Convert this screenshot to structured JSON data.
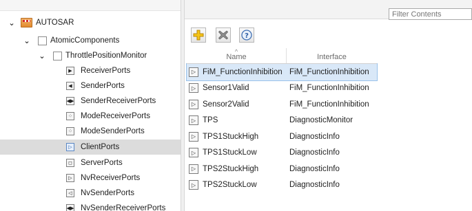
{
  "tree": {
    "root": {
      "label": "AUTOSAR",
      "expanded": true,
      "icon": "autosar-package-icon"
    },
    "package": {
      "label": "AtomicComponents",
      "expanded": true,
      "icon": "folder-icon"
    },
    "component": {
      "label": "ThrottlePositionMonitor",
      "expanded": true,
      "icon": "folder-icon"
    },
    "children": [
      {
        "label": "ReceiverPorts",
        "icon": "receiver-port-icon",
        "glyph": "▶",
        "selected": false
      },
      {
        "label": "SenderPorts",
        "icon": "sender-port-icon",
        "glyph": "◀",
        "selected": false
      },
      {
        "label": "SenderReceiverPorts",
        "icon": "sender-receiver-port-icon",
        "glyph": "◀▶",
        "selected": false
      },
      {
        "label": "ModeReceiverPorts",
        "icon": "mode-receiver-port-icon",
        "glyph": "⁘",
        "selected": false
      },
      {
        "label": "ModeSenderPorts",
        "icon": "mode-sender-port-icon",
        "glyph": "⁘",
        "selected": false
      },
      {
        "label": "ClientPorts",
        "icon": "client-port-icon",
        "glyph": "▷",
        "selected": true
      },
      {
        "label": "ServerPorts",
        "icon": "server-port-icon",
        "glyph": "◻",
        "selected": false
      },
      {
        "label": "NvReceiverPorts",
        "icon": "nv-receiver-port-icon",
        "glyph": "▷",
        "selected": false
      },
      {
        "label": "NvSenderPorts",
        "icon": "nv-sender-port-icon",
        "glyph": "◁",
        "selected": false
      },
      {
        "label": "NvSenderReceiverPorts",
        "icon": "nv-sender-receiver-port-icon",
        "glyph": "◀▶",
        "selected": false
      }
    ]
  },
  "filter": {
    "placeholder": "Filter Contents",
    "value": ""
  },
  "toolbar": {
    "add_icon": "add-icon",
    "delete_icon": "delete-icon",
    "help_icon": "help-icon"
  },
  "table": {
    "columns": {
      "name": "Name",
      "interface": "Interface"
    },
    "sort_indicator": "^",
    "rows": [
      {
        "name": "FiM_FunctionInhibition",
        "interface": "FiM_FunctionInhibition",
        "selected": true
      },
      {
        "name": "Sensor1Valid",
        "interface": "FiM_FunctionInhibition",
        "selected": false
      },
      {
        "name": "Sensor2Valid",
        "interface": "FiM_FunctionInhibition",
        "selected": false
      },
      {
        "name": "TPS",
        "interface": "DiagnosticMonitor",
        "selected": false
      },
      {
        "name": "TPS1StuckHigh",
        "interface": "DiagnosticInfo",
        "selected": false
      },
      {
        "name": "TPS1StuckLow",
        "interface": "DiagnosticInfo",
        "selected": false
      },
      {
        "name": "TPS2StuckHigh",
        "interface": "DiagnosticInfo",
        "selected": false
      },
      {
        "name": "TPS2StuckLow",
        "interface": "DiagnosticInfo",
        "selected": false
      }
    ]
  },
  "colors": {
    "selected_row": "#d9e8f8",
    "selected_tree_item": "#dcdcdc",
    "package_orange": "#e28a2e"
  }
}
